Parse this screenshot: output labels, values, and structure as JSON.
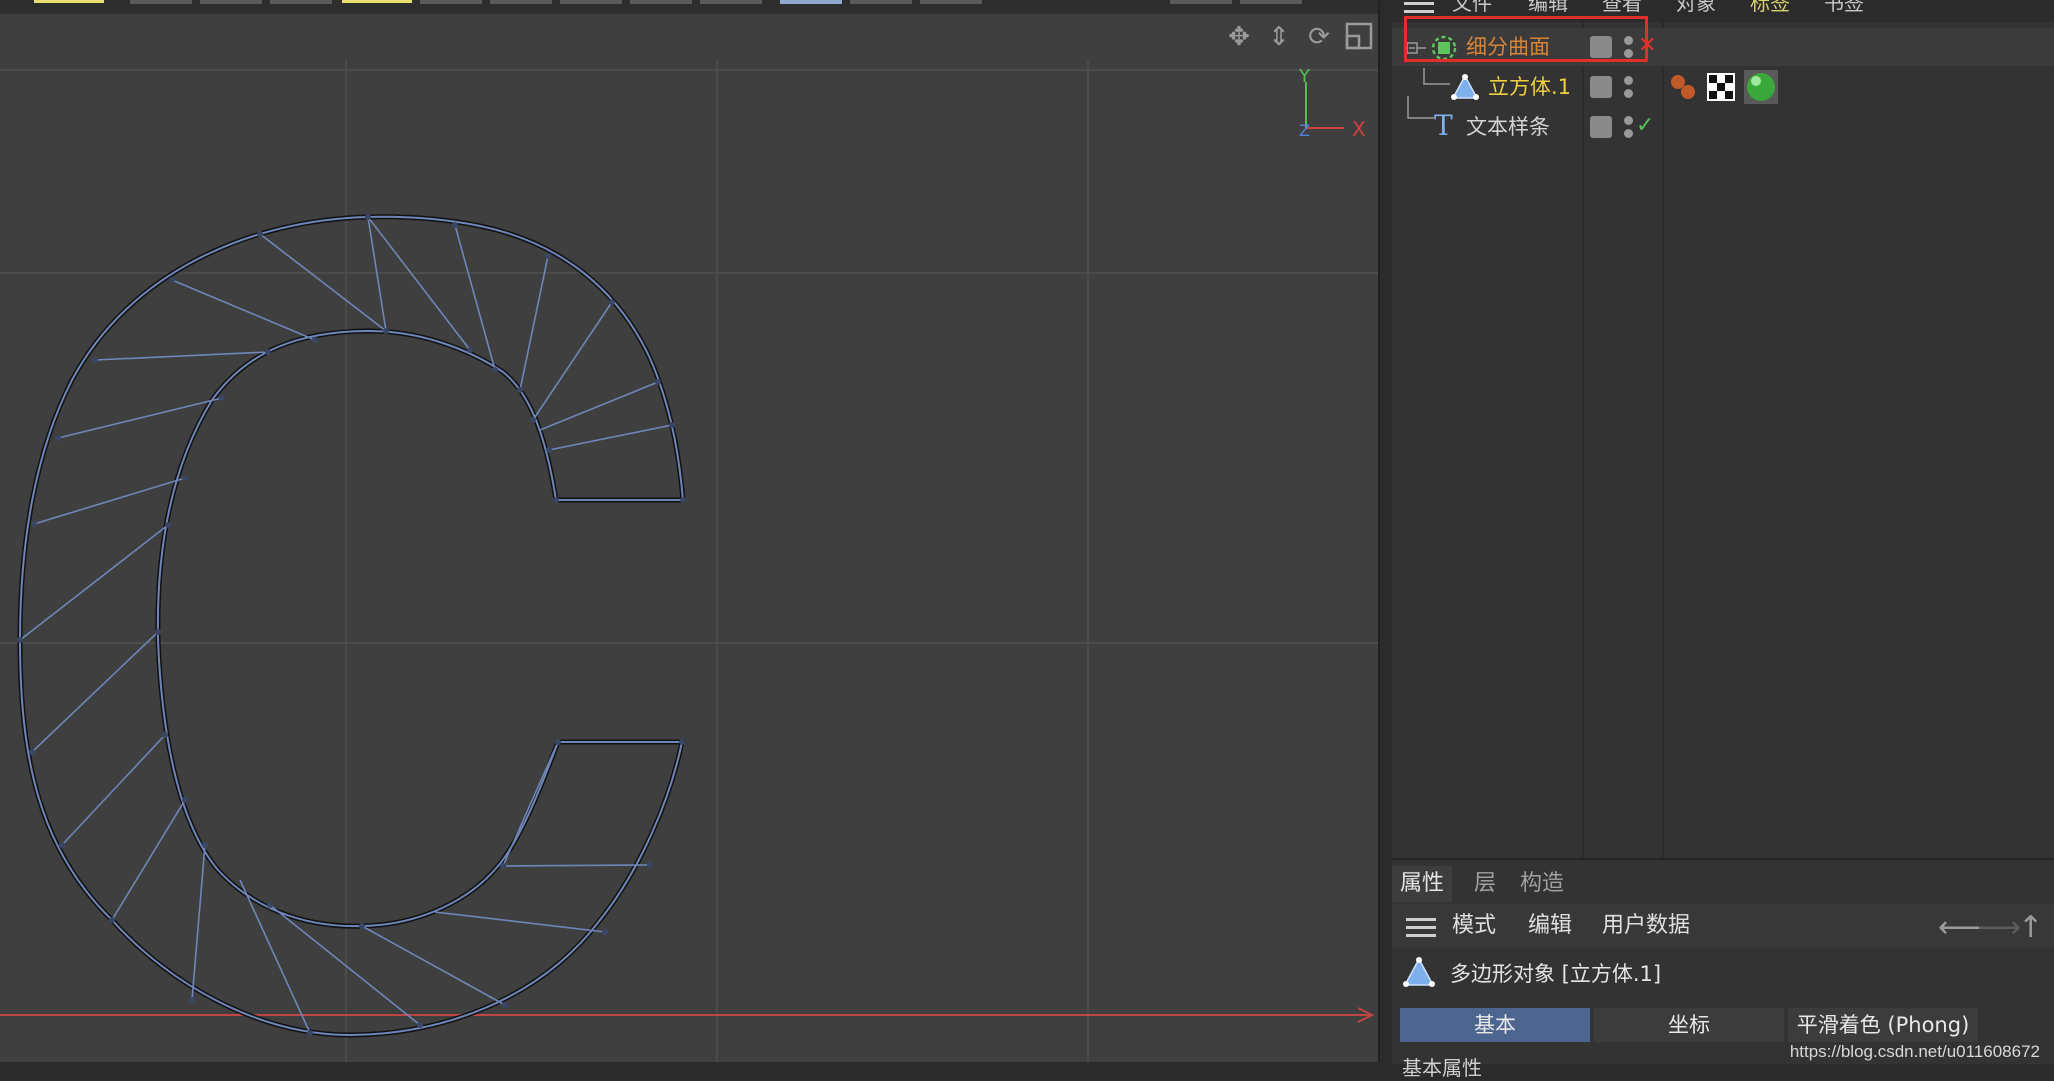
{
  "viewport": {
    "axis_y_label": "Y",
    "axis_z_label": "Z",
    "axis_x_label": "X",
    "icons": [
      "move-icon",
      "move-vertical-icon",
      "rotate-icon",
      "maximize-icon"
    ]
  },
  "menubar": {
    "items": [
      "文件",
      "编辑",
      "查看",
      "对象",
      "标签",
      "书签"
    ]
  },
  "objects": [
    {
      "name": "细分曲面",
      "icon": "subdivision-surface-icon",
      "color": "#d6843a",
      "status": "✕",
      "status_color": "#e0302a"
    },
    {
      "name": "立方体.1",
      "icon": "polygon-object-icon",
      "color": "#f0d040",
      "status": "",
      "status_color": ""
    },
    {
      "name": "文本样条",
      "icon": "text-spline-icon",
      "color": "#d4d4d4",
      "status": "✓",
      "status_color": "#58c058"
    }
  ],
  "attributes": {
    "tabs": [
      "属性",
      "层",
      "构造"
    ],
    "active_tab": "属性",
    "menu": [
      "模式",
      "编辑",
      "用户数据"
    ],
    "object_label": "多边形对象 [立方体.1]",
    "subtabs": [
      "基本",
      "坐标",
      "平滑着色 (Phong)"
    ],
    "active_subtab": "基本",
    "cut_text": "基本属性"
  },
  "watermark": "https://blog.csdn.net/u011608672",
  "colors": {
    "viewport_bg": "#3f3f3f",
    "grid": "#4a4a4a",
    "wire": "#6f86b8",
    "x_axis": "#d04040",
    "highlight": "#e0302a",
    "active_subtab": "#4c6690"
  }
}
